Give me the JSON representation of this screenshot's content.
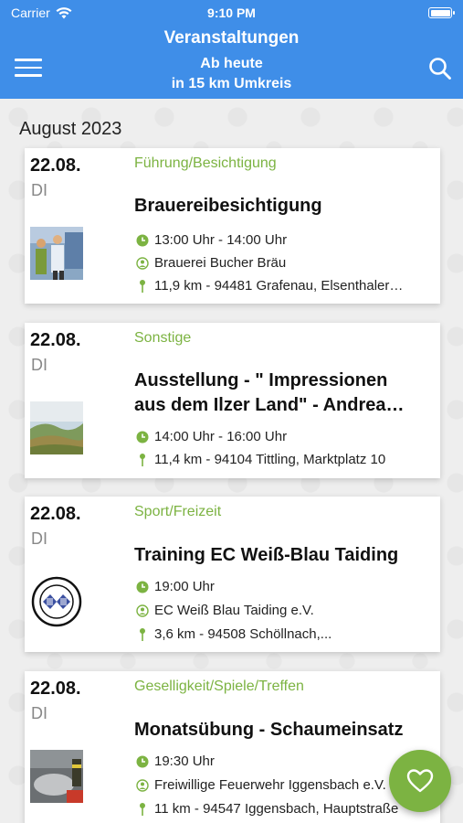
{
  "status_bar": {
    "carrier": "Carrier",
    "time": "9:10 PM"
  },
  "header": {
    "title": "Veranstaltungen",
    "subtitle_line1": "Ab heute",
    "subtitle_line2": "in 15 km Umkreis"
  },
  "month": "August 2023",
  "events": [
    {
      "date": "22.08.",
      "day": "DI",
      "category": "Führung/Besichtigung",
      "title_line1": "Brauereibesichtigung",
      "title_line2": "",
      "time": "13:00 Uhr - 14:00 Uhr",
      "organizer": "Brauerei Bucher Bräu",
      "location": "11,9 km -  94481 Grafenau, Elsenthaler…"
    },
    {
      "date": "22.08.",
      "day": "DI",
      "category": "Sonstige",
      "title_line1": "Ausstellung - \" Impressionen",
      "title_line2": "aus dem Ilzer Land\" - Andrea…",
      "time": "14:00 Uhr - 16:00 Uhr",
      "organizer": "",
      "location": "11,4 km -  94104 Tittling, Marktplatz 10"
    },
    {
      "date": "22.08.",
      "day": "DI",
      "category": "Sport/Freizeit",
      "title_line1": "Training EC Weiß-Blau Taiding",
      "title_line2": "",
      "time": "19:00 Uhr",
      "organizer": "EC Weiß Blau Taiding e.V.",
      "location": "3,6 km -  94508 Schöllnach,..."
    },
    {
      "date": "22.08.",
      "day": "DI",
      "category": "Geselligkeit/Spiele/Treffen",
      "title_line1": "Monatsübung - Schaumeinsatz",
      "title_line2": "",
      "time": "19:30 Uhr",
      "organizer": "Freiwillige Feuerwehr Iggensbach e.V.",
      "location": "11 km -  94547 Iggensbach, Hauptstraße"
    }
  ],
  "icons": {
    "clock": "clock-icon",
    "organizer": "person-circle-icon",
    "location": "pin-icon",
    "menu": "hamburger-menu-icon",
    "search": "search-icon",
    "favorite": "heart-icon"
  },
  "colors": {
    "header": "#3f8ee8",
    "accent_green": "#7cb342"
  }
}
